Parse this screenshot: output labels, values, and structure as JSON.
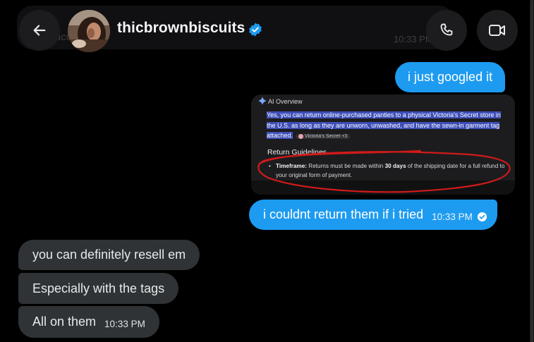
{
  "header": {
    "username": "thicbrownbiscuits",
    "ghost_text": "accept",
    "ghost_time": "10:33 PM",
    "icons": {
      "back": "arrow-left-icon",
      "call": "phone-icon",
      "video": "video-camera-icon",
      "verified": "verified-badge-icon"
    }
  },
  "messages": {
    "out1": {
      "text": "i just googled it"
    },
    "attachment": {
      "ai_label": "AI Overview",
      "highlight_text": "Yes, you can return online-purchased panties to a physical Victoria's Secret store in the U.S. as long as they are unworn, unwashed, and have the sewn-in garment tag attached.",
      "source_chip": "Victoria's Secret +3",
      "section_title": "Return Guidelines",
      "bullet_label": "Timeframe:",
      "bullet_pre": "Returns must be made within",
      "bullet_bold": "30 days",
      "bullet_post": "of the shipping date for a full refund to your original form of payment."
    },
    "out2": {
      "text": "i couldnt return them if i tried",
      "time": "10:33 PM",
      "status_icon": "sent-check-icon"
    },
    "in1": {
      "text": "you can definitely resell em"
    },
    "in2": {
      "text": "Especially with the tags"
    },
    "in3": {
      "text": "All on them",
      "time": "10:33 PM"
    }
  },
  "colors": {
    "background": "#000000",
    "outgoing_bubble": "#1d9bf0",
    "incoming_bubble": "#2f3336",
    "verified": "#1d9bf0",
    "red_annotation": "#d11a1a"
  }
}
